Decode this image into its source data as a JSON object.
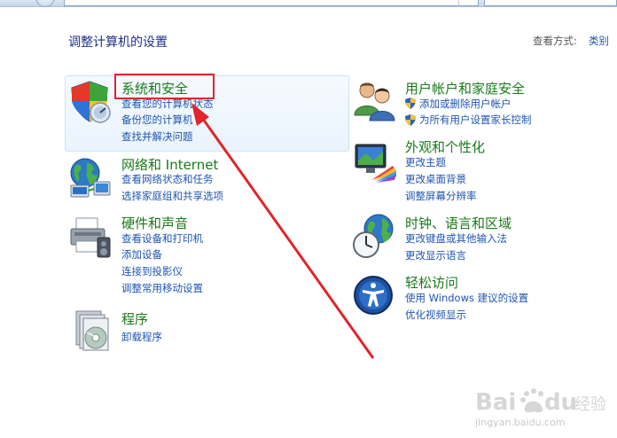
{
  "header": {
    "title": "调整计算机的设置",
    "view_by_label": "查看方式:",
    "view_by_value": "类别"
  },
  "categories": [
    {
      "title": "系统和安全",
      "icon": "shield-icon",
      "links": [
        "查看您的计算机状态",
        "备份您的计算机",
        "查找并解决问题"
      ]
    },
    {
      "title": "网络和 Internet",
      "icon": "network-globe-icon",
      "links": [
        "查看网络状态和任务",
        "选择家庭组和共享选项"
      ]
    },
    {
      "title": "硬件和声音",
      "icon": "printer-icon",
      "links": [
        "查看设备和打印机",
        "添加设备",
        "连接到投影仪",
        "调整常用移动设置"
      ]
    },
    {
      "title": "程序",
      "icon": "programs-disc-icon",
      "links": [
        "卸载程序"
      ]
    },
    {
      "title": "用户帐户和家庭安全",
      "icon": "users-icon",
      "links": [
        "添加或删除用户帐户",
        "为所有用户设置家长控制"
      ]
    },
    {
      "title": "外观和个性化",
      "icon": "monitor-palette-icon",
      "links": [
        "更改主题",
        "更改桌面背景",
        "调整屏幕分辨率"
      ]
    },
    {
      "title": "时钟、语言和区域",
      "icon": "clock-globe-icon",
      "links": [
        "更改键盘或其他输入法",
        "更改显示语言"
      ]
    },
    {
      "title": "轻松访问",
      "icon": "accessibility-icon",
      "links": [
        "使用 Windows 建议的设置",
        "优化视频显示"
      ]
    }
  ],
  "watermark": {
    "brand": "Baidu 经验",
    "url": "jingyan.baidu.com"
  },
  "colors": {
    "title_blue": "#1e3287",
    "category_green": "#1a7a1a",
    "link_blue": "#1f55b4",
    "highlight_red": "#e0252b"
  }
}
